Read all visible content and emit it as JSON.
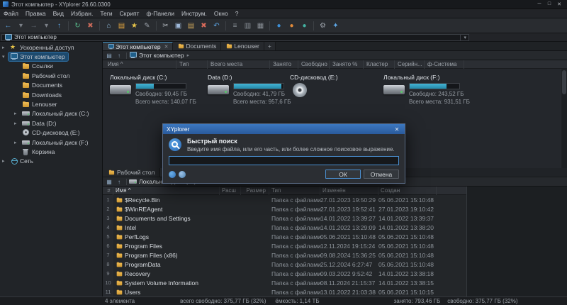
{
  "window": {
    "title": "Этот компьютер - XYplorer 26.60.0300",
    "minimize": "─",
    "maximize": "□",
    "close": "✕"
  },
  "menu": {
    "items": [
      "Файл",
      "Правка",
      "Вид",
      "Избран.",
      "Теги",
      "Скрипт",
      "ф-Панели",
      "Инструм.",
      "Окно",
      "?"
    ]
  },
  "toolbar": {
    "items": [
      {
        "name": "back-icon",
        "glyph": "←",
        "color": "#5ea8e8"
      },
      {
        "name": "back-dropdown-icon",
        "glyph": "▾",
        "color": "#7b8088"
      },
      {
        "name": "forward-icon",
        "glyph": "→",
        "color": "#697179"
      },
      {
        "name": "forward-dropdown-icon",
        "glyph": "▾",
        "color": "#7b8088"
      },
      {
        "name": "up-icon",
        "glyph": "↑",
        "color": "#5ea8e8"
      },
      {
        "name": "toolbar-separator",
        "sep": true
      },
      {
        "name": "refresh-icon",
        "glyph": "↻",
        "color": "#58b98a"
      },
      {
        "name": "stop-icon",
        "glyph": "✖",
        "color": "#c96a5a"
      },
      {
        "name": "toolbar-separator",
        "sep": true
      },
      {
        "name": "home-icon",
        "glyph": "⌂",
        "color": "#8fb9d9"
      },
      {
        "name": "new-folder-icon",
        "glyph": "▤",
        "color": "#e0a33e"
      },
      {
        "name": "favorites-icon",
        "glyph": "★",
        "color": "#e8c54a"
      },
      {
        "name": "edit-icon",
        "glyph": "✎",
        "color": "#9aa0a8"
      },
      {
        "name": "toolbar-separator",
        "sep": true
      },
      {
        "name": "cut-icon",
        "glyph": "✂",
        "color": "#b9bec5"
      },
      {
        "name": "copy-icon",
        "glyph": "▣",
        "color": "#9fb9d9"
      },
      {
        "name": "paste-icon",
        "glyph": "▤",
        "color": "#c9a35a"
      },
      {
        "name": "delete-icon",
        "glyph": "✖",
        "color": "#d86a5a"
      },
      {
        "name": "undo-icon",
        "glyph": "↶",
        "color": "#5ea8e8"
      },
      {
        "name": "toolbar-separator",
        "sep": true
      },
      {
        "name": "tree-toggle-icon",
        "glyph": "≡",
        "color": "#8a9097"
      },
      {
        "name": "dual-pane-icon",
        "glyph": "▥",
        "color": "#8a9097"
      },
      {
        "name": "flat-view-icon",
        "glyph": "▦",
        "color": "#8a9097"
      },
      {
        "name": "toolbar-separator",
        "sep": true
      },
      {
        "name": "sphere-blue-icon",
        "glyph": "●",
        "color": "#3d8fd6"
      },
      {
        "name": "sphere-orange-icon",
        "glyph": "●",
        "color": "#e08a3a"
      },
      {
        "name": "sphere-teal-icon",
        "glyph": "●",
        "color": "#43b0a0"
      },
      {
        "name": "toolbar-separator",
        "sep": true
      },
      {
        "name": "settings-icon",
        "glyph": "⚙",
        "color": "#9aa0a8"
      },
      {
        "name": "tools-icon",
        "glyph": "✦",
        "color": "#5ea8e8"
      }
    ]
  },
  "address": {
    "value": "Этот компьютер",
    "dropdown": "▾"
  },
  "tabbar": {
    "tabs": [
      {
        "name": "tab-this-pc",
        "label": "Этот компьютер",
        "icon": "computer",
        "icon_name": "computer-icon",
        "active": true,
        "close": "✕"
      },
      {
        "name": "tab-documents",
        "label": "Documents",
        "icon": "folder",
        "icon_name": "folder-icon"
      },
      {
        "name": "tab-lenouser",
        "label": "Lenouser",
        "icon": "folder",
        "icon_name": "folder-icon"
      },
      {
        "name": "tab-new",
        "label": "+",
        "newtab": true
      }
    ]
  },
  "crumb": {
    "btn1": "▤",
    "btn2": "↑",
    "path": "Этот компьютер",
    "chevron": "▸"
  },
  "sidebar": {
    "items": [
      {
        "name": "sidebar-item-quick-access",
        "label": "Ускоренный доступ",
        "icon": "star",
        "icon_name": "star-icon",
        "level": 0,
        "expander": "▸"
      },
      {
        "name": "sidebar-item-this-pc",
        "label": "Этот компьютер",
        "icon": "computer",
        "icon_name": "computer-icon",
        "level": 0,
        "expander": "▾",
        "selected": true
      },
      {
        "name": "sidebar-item-links",
        "label": "Ссылки",
        "icon": "folder",
        "icon_name": "folder-icon",
        "level": 1
      },
      {
        "name": "sidebar-item-desktop",
        "label": "Рабочий стол",
        "icon": "folder",
        "icon_name": "folder-icon",
        "level": 1
      },
      {
        "name": "sidebar-item-documents",
        "label": "Documents",
        "icon": "folder",
        "icon_name": "folder-icon",
        "level": 1
      },
      {
        "name": "sidebar-item-downloads",
        "label": "Downloads",
        "icon": "folder",
        "icon_name": "folder-icon",
        "level": 1
      },
      {
        "name": "sidebar-item-lenouser",
        "label": "Lenouser",
        "icon": "folder",
        "icon_name": "folder-icon",
        "level": 1
      },
      {
        "name": "sidebar-item-drive-c",
        "label": "Локальный диск (C:)",
        "icon": "hdd",
        "icon_name": "hdd-icon",
        "level": 1,
        "expander": "▸"
      },
      {
        "name": "sidebar-item-drive-d",
        "label": "Data (D:)",
        "icon": "hdd",
        "icon_name": "hdd-icon",
        "level": 1,
        "expander": "▸"
      },
      {
        "name": "sidebar-item-drive-e",
        "label": "CD-дисковод (E:)",
        "icon": "cd",
        "icon_name": "cd-icon",
        "level": 1
      },
      {
        "name": "sidebar-item-drive-f",
        "label": "Локальный диск (F:)",
        "icon": "hdd",
        "icon_name": "hdd-icon",
        "level": 1,
        "expander": "▸"
      },
      {
        "name": "sidebar-item-recycle-bin",
        "label": "Корзина",
        "icon": "trash",
        "icon_name": "trash-icon",
        "level": 1
      },
      {
        "name": "sidebar-item-network",
        "label": "Сеть",
        "icon": "network",
        "icon_name": "network-icon",
        "level": 0,
        "expander": "▸"
      }
    ]
  },
  "drive_pane": {
    "columns": [
      "Имя ^",
      "Тип",
      "Всего места",
      "Занято",
      "Свободно",
      "Занято %",
      "Кластер",
      "Серийн...",
      "ф-Система"
    ],
    "drives": [
      {
        "name": "drive-tile-c",
        "label": "Локальный диск (C:)",
        "icon": "hdd",
        "icon_name": "hdd-icon",
        "has_bar": true,
        "used_pct": 35,
        "free": "Свободно: 90,45 ГБ",
        "total": "Всего места: 140,07 ГБ"
      },
      {
        "name": "drive-tile-d",
        "label": "Data (D:)",
        "icon": "hdd",
        "icon_name": "hdd-icon",
        "has_bar": true,
        "used_pct": 96,
        "free": "Свободно: 41,79 ГБ",
        "total": "Всего места: 957,6 ГБ"
      },
      {
        "name": "drive-tile-e",
        "label": "CD-дисковод (E:)",
        "icon": "cd",
        "icon_name": "cd-icon",
        "has_bar": false,
        "free": "",
        "total": ""
      },
      {
        "name": "drive-tile-f",
        "label": "Локальный диск (F:)",
        "icon": "hdd",
        "icon_name": "hdd-icon",
        "has_bar": true,
        "used_pct": 74,
        "free": "Свободно: 243,52 ГБ",
        "total": "Всего места: 931,51 ГБ"
      }
    ]
  },
  "bottom_pane": {
    "tabs": [
      {
        "name": "btab-desktop",
        "label": "Рабочий стол",
        "icon": "folder",
        "icon_name": "folder-icon"
      },
      {
        "name": "btab-drive-c",
        "label": "",
        "icon": "hdd",
        "icon_name": "hdd-icon",
        "active": true
      }
    ],
    "crumb": {
      "btn1": "▦",
      "btn2": "↑",
      "path": "Локальный диск (C:)",
      "chevron": "▸"
    },
    "columns": [
      "#",
      "Имя ^",
      "Расш",
      "Размер",
      "Тип",
      "Изменён",
      "Создан"
    ],
    "rows": [
      {
        "n": 1,
        "name": "$Recycle.Bin",
        "ext": "",
        "size": "",
        "type": "Папка с файлами",
        "modified": "27.01.2023 19:50:29",
        "created": "05.06.2021 15:10:48"
      },
      {
        "n": 2,
        "name": "$WinREAgent",
        "ext": "",
        "size": "",
        "type": "Папка с файлами",
        "modified": "27.01.2023 19:52:41",
        "created": "27.01.2023 19:10:42"
      },
      {
        "n": 3,
        "name": "Documents and Settings",
        "ext": "",
        "size": "",
        "type": "Папка с файлами",
        "modified": "14.01.2022 13:39:27",
        "created": "14.01.2022 13:39:37"
      },
      {
        "n": 4,
        "name": "Intel",
        "ext": "",
        "size": "",
        "type": "Папка с файлами",
        "modified": "14.01.2022 13:29:09",
        "created": "14.01.2022 13:38:20"
      },
      {
        "n": 5,
        "name": "PerfLogs",
        "ext": "",
        "size": "",
        "type": "Папка с файлами",
        "modified": "05.06.2021 15:10:48",
        "created": "05.06.2021 15:10:48"
      },
      {
        "n": 6,
        "name": "Program Files",
        "ext": "",
        "size": "",
        "type": "Папка с файлами",
        "modified": "12.11.2024 19:15:24",
        "created": "05.06.2021 15:10:48"
      },
      {
        "n": 7,
        "name": "Program Files (x86)",
        "ext": "",
        "size": "",
        "type": "Папка с файлами",
        "modified": "09.08.2024 15:36:25",
        "created": "05.06.2021 15:10:48"
      },
      {
        "n": 8,
        "name": "ProgramData",
        "ext": "",
        "size": "",
        "type": "Папка с файлами",
        "modified": "25.12.2024 6:27:47",
        "created": "05.06.2021 15:10:48"
      },
      {
        "n": 9,
        "name": "Recovery",
        "ext": "",
        "size": "",
        "type": "Папка с файлами",
        "modified": "09.03.2022 9:52:42",
        "created": "14.01.2022 13:38:18"
      },
      {
        "n": 10,
        "name": "System Volume Information",
        "ext": "",
        "size": "",
        "type": "Папка с файлами",
        "modified": "08.11.2024 21:15:37",
        "created": "14.01.2022 13:38:15"
      },
      {
        "n": 11,
        "name": "Users",
        "ext": "",
        "size": "",
        "type": "Папка с файлами",
        "modified": "13.01.2022 21:03:38",
        "created": "05.06.2021 15:10:15"
      }
    ]
  },
  "statusbar": {
    "segments": [
      {
        "name": "status-item-count",
        "text": "4 элемента"
      },
      {
        "name": "status-total-free",
        "text": "всего  свободно: 375,77 ГБ (32%)"
      },
      {
        "name": "status-capacity",
        "text": "ёмкость: 1,14 ТБ"
      },
      {
        "name": "status-used",
        "text": "занято: 793,46 ГБ"
      },
      {
        "name": "status-free",
        "text": "свободно: 375,77 ГБ (32%)"
      }
    ]
  },
  "dialog": {
    "title": "XYplorer",
    "close": "✕",
    "heading": "Быстрый поиск",
    "message": "Введите имя файла, или его часть, или более сложное поисковое выражение.",
    "input_value": "",
    "ok_label": "ОК",
    "cancel_label": "Отмена"
  },
  "colors": {
    "accent": "#2f9dbd",
    "dialog_title": "#2a5a9c",
    "selection": "#1d4a6e"
  }
}
